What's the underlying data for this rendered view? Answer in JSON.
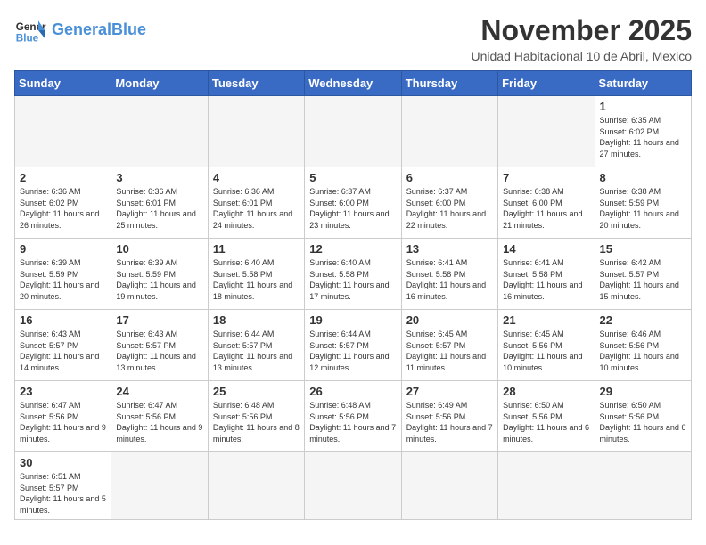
{
  "logo": {
    "text_general": "General",
    "text_blue": "Blue"
  },
  "header": {
    "month": "November 2025",
    "location": "Unidad Habitacional 10 de Abril, Mexico"
  },
  "weekdays": [
    "Sunday",
    "Monday",
    "Tuesday",
    "Wednesday",
    "Thursday",
    "Friday",
    "Saturday"
  ],
  "days": {
    "1": {
      "sunrise": "6:35 AM",
      "sunset": "6:02 PM",
      "daylight": "11 hours and 27 minutes."
    },
    "2": {
      "sunrise": "6:36 AM",
      "sunset": "6:02 PM",
      "daylight": "11 hours and 26 minutes."
    },
    "3": {
      "sunrise": "6:36 AM",
      "sunset": "6:01 PM",
      "daylight": "11 hours and 25 minutes."
    },
    "4": {
      "sunrise": "6:36 AM",
      "sunset": "6:01 PM",
      "daylight": "11 hours and 24 minutes."
    },
    "5": {
      "sunrise": "6:37 AM",
      "sunset": "6:00 PM",
      "daylight": "11 hours and 23 minutes."
    },
    "6": {
      "sunrise": "6:37 AM",
      "sunset": "6:00 PM",
      "daylight": "11 hours and 22 minutes."
    },
    "7": {
      "sunrise": "6:38 AM",
      "sunset": "6:00 PM",
      "daylight": "11 hours and 21 minutes."
    },
    "8": {
      "sunrise": "6:38 AM",
      "sunset": "5:59 PM",
      "daylight": "11 hours and 20 minutes."
    },
    "9": {
      "sunrise": "6:39 AM",
      "sunset": "5:59 PM",
      "daylight": "11 hours and 20 minutes."
    },
    "10": {
      "sunrise": "6:39 AM",
      "sunset": "5:59 PM",
      "daylight": "11 hours and 19 minutes."
    },
    "11": {
      "sunrise": "6:40 AM",
      "sunset": "5:58 PM",
      "daylight": "11 hours and 18 minutes."
    },
    "12": {
      "sunrise": "6:40 AM",
      "sunset": "5:58 PM",
      "daylight": "11 hours and 17 minutes."
    },
    "13": {
      "sunrise": "6:41 AM",
      "sunset": "5:58 PM",
      "daylight": "11 hours and 16 minutes."
    },
    "14": {
      "sunrise": "6:41 AM",
      "sunset": "5:58 PM",
      "daylight": "11 hours and 16 minutes."
    },
    "15": {
      "sunrise": "6:42 AM",
      "sunset": "5:57 PM",
      "daylight": "11 hours and 15 minutes."
    },
    "16": {
      "sunrise": "6:43 AM",
      "sunset": "5:57 PM",
      "daylight": "11 hours and 14 minutes."
    },
    "17": {
      "sunrise": "6:43 AM",
      "sunset": "5:57 PM",
      "daylight": "11 hours and 13 minutes."
    },
    "18": {
      "sunrise": "6:44 AM",
      "sunset": "5:57 PM",
      "daylight": "11 hours and 13 minutes."
    },
    "19": {
      "sunrise": "6:44 AM",
      "sunset": "5:57 PM",
      "daylight": "11 hours and 12 minutes."
    },
    "20": {
      "sunrise": "6:45 AM",
      "sunset": "5:57 PM",
      "daylight": "11 hours and 11 minutes."
    },
    "21": {
      "sunrise": "6:45 AM",
      "sunset": "5:56 PM",
      "daylight": "11 hours and 10 minutes."
    },
    "22": {
      "sunrise": "6:46 AM",
      "sunset": "5:56 PM",
      "daylight": "11 hours and 10 minutes."
    },
    "23": {
      "sunrise": "6:47 AM",
      "sunset": "5:56 PM",
      "daylight": "11 hours and 9 minutes."
    },
    "24": {
      "sunrise": "6:47 AM",
      "sunset": "5:56 PM",
      "daylight": "11 hours and 9 minutes."
    },
    "25": {
      "sunrise": "6:48 AM",
      "sunset": "5:56 PM",
      "daylight": "11 hours and 8 minutes."
    },
    "26": {
      "sunrise": "6:48 AM",
      "sunset": "5:56 PM",
      "daylight": "11 hours and 7 minutes."
    },
    "27": {
      "sunrise": "6:49 AM",
      "sunset": "5:56 PM",
      "daylight": "11 hours and 7 minutes."
    },
    "28": {
      "sunrise": "6:50 AM",
      "sunset": "5:56 PM",
      "daylight": "11 hours and 6 minutes."
    },
    "29": {
      "sunrise": "6:50 AM",
      "sunset": "5:56 PM",
      "daylight": "11 hours and 6 minutes."
    },
    "30": {
      "sunrise": "6:51 AM",
      "sunset": "5:57 PM",
      "daylight": "11 hours and 5 minutes."
    }
  }
}
